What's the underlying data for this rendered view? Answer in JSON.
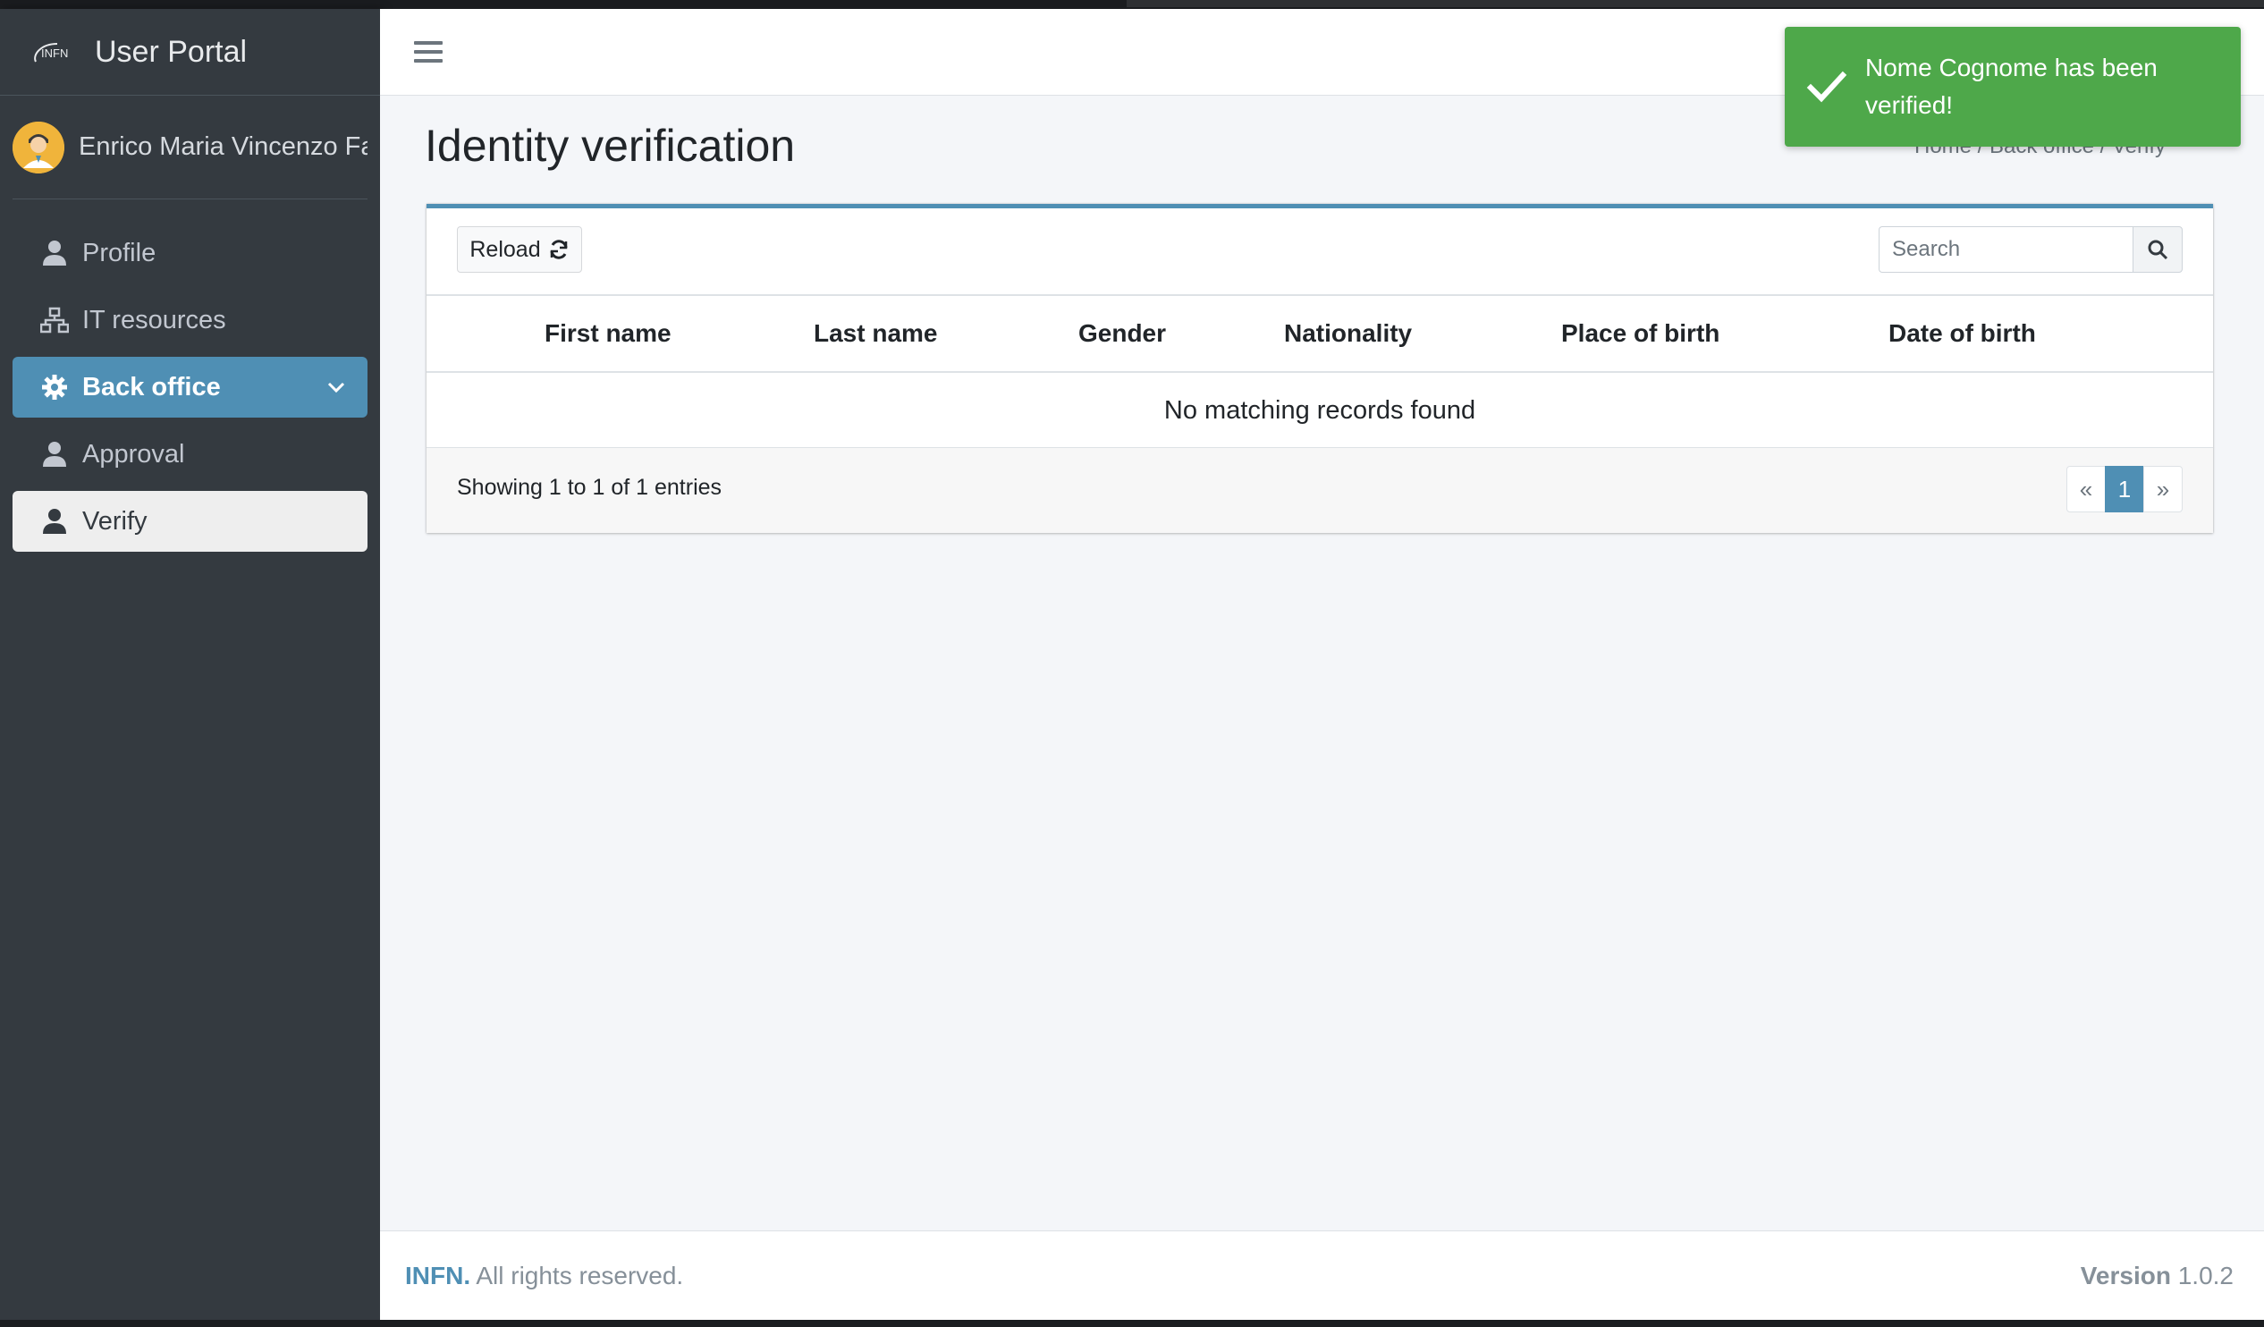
{
  "brand": {
    "logo_text": "INFN",
    "title": "User Portal"
  },
  "user": {
    "name": "Enrico Maria Vincenzo Fa"
  },
  "sidebar": {
    "items": [
      {
        "label": "Profile",
        "icon": "user-icon"
      },
      {
        "label": "IT resources",
        "icon": "sitemap-icon"
      },
      {
        "label": "Back office",
        "icon": "gear-icon",
        "expanded": true
      },
      {
        "label": "Approval",
        "icon": "user-icon"
      },
      {
        "label": "Verify",
        "icon": "user-icon",
        "selected": true
      }
    ]
  },
  "page": {
    "title": "Identity verification",
    "breadcrumb": "Home / Back office / Verify"
  },
  "toolbar": {
    "reload_label": "Reload",
    "search_placeholder": "Search"
  },
  "table": {
    "columns": [
      "First name",
      "Last name",
      "Gender",
      "Nationality",
      "Place of birth",
      "Date of birth"
    ],
    "empty_message": "No matching records found",
    "info": "Showing 1 to 1 of 1 entries"
  },
  "pagination": {
    "prev": "«",
    "current": "1",
    "next": "»"
  },
  "footer": {
    "org": "INFN.",
    "rights": " All rights reserved.",
    "version_label": "Version",
    "version": "1.0.2"
  },
  "toast": {
    "message": "Nome Cognome has been verified!",
    "type": "success"
  },
  "colors": {
    "accent": "#4f8fb4",
    "sidebar_bg": "#343a40",
    "toast_success": "#4ea84a"
  }
}
